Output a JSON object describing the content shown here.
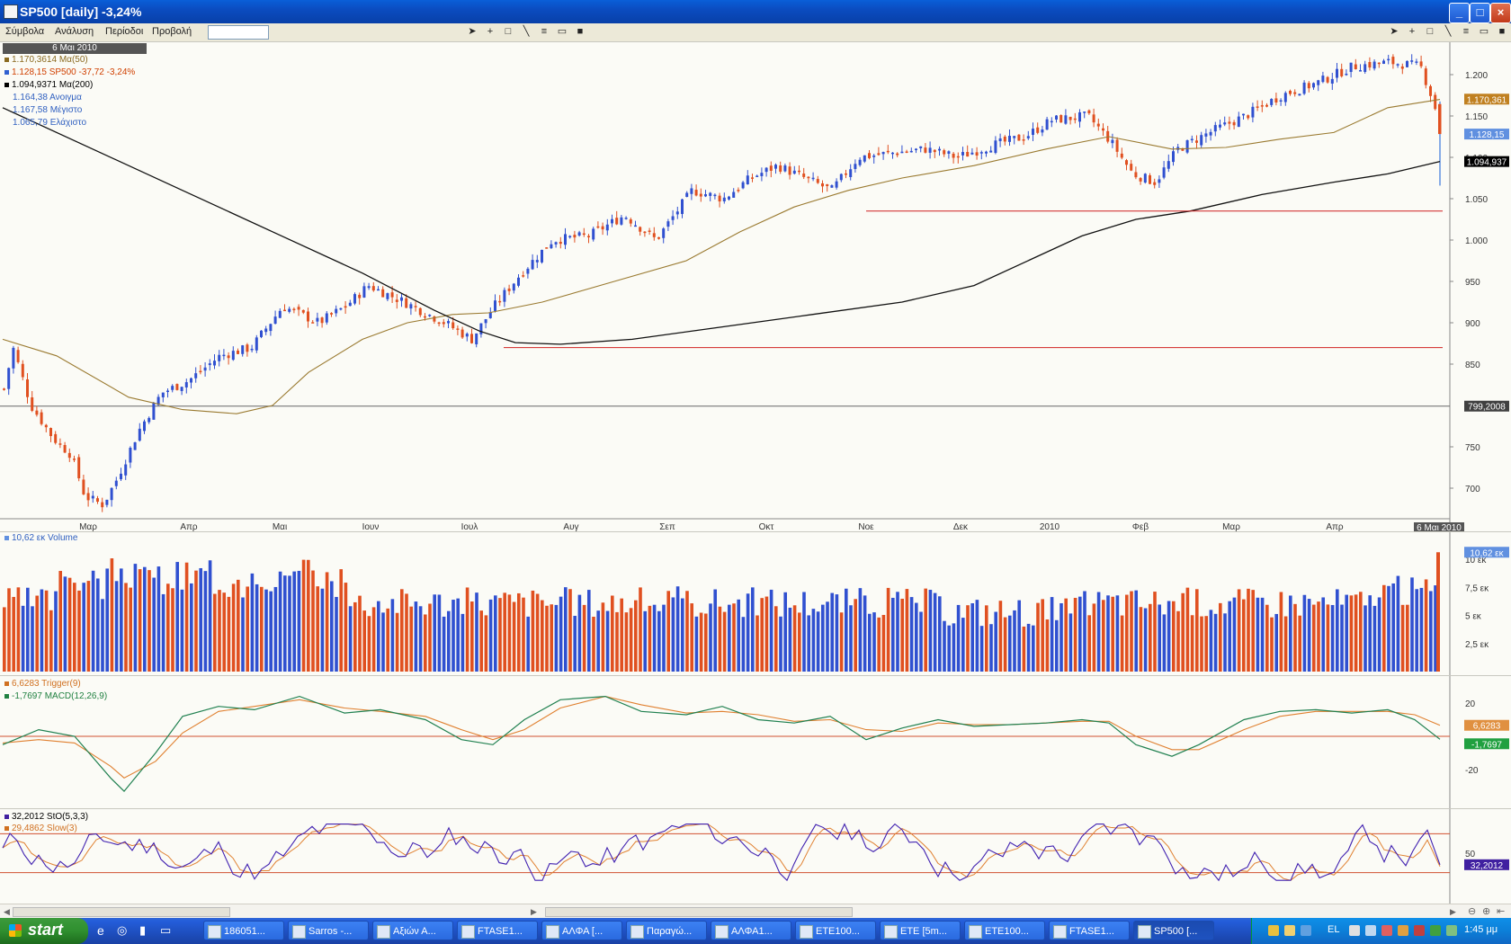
{
  "window": {
    "title": "SP500 [daily] -3,24%"
  },
  "menu": {
    "items": [
      "Σύμβολα",
      "Ανάλυση",
      "Περίοδοι",
      "Προβολή"
    ]
  },
  "price_panel": {
    "date_header": "6 Μαι 2010",
    "legend": [
      {
        "text": "1.170,3614 Mα(50)",
        "color": "#8a6a20"
      },
      {
        "text": "1.128,15 SP500 -37,72 -3,24%",
        "color": "#d04000",
        "prefix_color": "#3060d0"
      },
      {
        "text": "1.094,9371 Mα(200)",
        "color": "#000000"
      },
      {
        "text": "1.164,38 Ανοιγμα",
        "color": "#3060c0"
      },
      {
        "text": "1.167,58 Μέγιστο",
        "color": "#3060c0"
      },
      {
        "text": "1.065,79 Ελάχιστο",
        "color": "#3060c0"
      }
    ],
    "y_ticks": [
      "1.200",
      "1.150",
      "1.100",
      "1.050",
      "1.000",
      "950",
      "900",
      "850",
      "750",
      "700"
    ],
    "y_tick_values": [
      1200,
      1150,
      1100,
      1050,
      1000,
      950,
      900,
      850,
      750,
      700
    ],
    "price_tags": [
      {
        "text": "1.170,361",
        "value": 1170.36,
        "bg": "#c08020",
        "fg": "#ffffff"
      },
      {
        "text": "1.128,15",
        "value": 1128.15,
        "bg": "#6090e0",
        "fg": "#ffffff"
      },
      {
        "text": "1.094,937",
        "value": 1094.94,
        "bg": "#000000",
        "fg": "#ffffff"
      },
      {
        "text": "799,2008",
        "value": 799.2,
        "bg": "#404040",
        "fg": "#ffffff"
      }
    ],
    "x_labels": [
      "Μαρ",
      "Απρ",
      "Μαι",
      "Ιουν",
      "Ιουλ",
      "Αυγ",
      "Σεπ",
      "Οκτ",
      "Νοε",
      "Δεκ",
      "2010",
      "Φεβ",
      "Μαρ",
      "Απρ"
    ],
    "x_end_label": "6 Μαι 2010",
    "colors": {
      "up": "#3050d0",
      "down": "#e05020",
      "ma50": "#9a7a30",
      "ma200": "#111111",
      "support": "#d02020"
    }
  },
  "volume_panel": {
    "legend": "10,62 εκ Volume",
    "y_ticks": [
      "10 εκ",
      "7,5 εκ",
      "5 εκ",
      "2,5 εκ"
    ],
    "last_tag": "10,62 εκ"
  },
  "macd_panel": {
    "legend": [
      {
        "text": "6,6283 Trigger(9)",
        "color": "#d07020"
      },
      {
        "text": "-1,7697 MACD(12,26,9)",
        "color": "#208040"
      }
    ],
    "y_ticks": [
      "20",
      "-20"
    ],
    "tags": [
      {
        "text": "6,6283",
        "bg": "#e09040"
      },
      {
        "text": "-1,7697",
        "bg": "#20a040"
      }
    ]
  },
  "stoch_panel": {
    "legend": [
      {
        "text": "32,2012 StO(5,3,3)",
        "color": "#4020a0"
      },
      {
        "text": "29,4862 Slow(3)",
        "color": "#d07020"
      }
    ],
    "y_ticks": [
      "50"
    ],
    "tag": "32,2012"
  },
  "taskbar": {
    "start_label": "start",
    "tasks": [
      "186051...",
      "Sarros -...",
      "Αξιών Α...",
      "FTASE1...",
      "ΑΛΦΑ [...",
      "Παραγώ...",
      "ΑΛΦΑ1...",
      "ETE100...",
      "ETE [5m...",
      "ETE100...",
      "FTASE1...",
      "SP500 [..."
    ],
    "active_task": 11,
    "lang": "EL",
    "clock": "1:45 μμ"
  },
  "chart_data": {
    "type": "line",
    "title": "SP500 [daily]",
    "series": [
      {
        "name": "SP500",
        "points": [
          [
            0,
            820
          ],
          [
            10,
            870
          ],
          [
            30,
            800
          ],
          [
            55,
            760
          ],
          [
            75,
            740
          ],
          [
            90,
            690
          ],
          [
            110,
            680
          ],
          [
            125,
            710
          ],
          [
            150,
            770
          ],
          [
            175,
            815
          ],
          [
            205,
            830
          ],
          [
            240,
            860
          ],
          [
            275,
            870
          ],
          [
            310,
            920
          ],
          [
            350,
            900
          ],
          [
            380,
            920
          ],
          [
            405,
            945
          ],
          [
            445,
            925
          ],
          [
            490,
            900
          ],
          [
            520,
            880
          ],
          [
            545,
            920
          ],
          [
            575,
            960
          ],
          [
            610,
            1000
          ],
          [
            650,
            1005
          ],
          [
            690,
            1030
          ],
          [
            725,
            1000
          ],
          [
            765,
            1060
          ],
          [
            800,
            1050
          ],
          [
            830,
            1075
          ],
          [
            860,
            1090
          ],
          [
            890,
            1075
          ],
          [
            920,
            1060
          ],
          [
            950,
            1100
          ],
          [
            985,
            1105
          ],
          [
            1025,
            1110
          ],
          [
            1060,
            1100
          ],
          [
            1100,
            1115
          ],
          [
            1135,
            1125
          ],
          [
            1165,
            1145
          ],
          [
            1205,
            1150
          ],
          [
            1230,
            1120
          ],
          [
            1255,
            1080
          ],
          [
            1280,
            1070
          ],
          [
            1305,
            1110
          ],
          [
            1340,
            1130
          ],
          [
            1380,
            1150
          ],
          [
            1420,
            1175
          ],
          [
            1460,
            1190
          ],
          [
            1500,
            1210
          ],
          [
            1540,
            1215
          ],
          [
            1575,
            1210
          ],
          [
            1590,
            1165
          ],
          [
            1598,
            1128
          ]
        ]
      },
      {
        "name": "Mα(50)",
        "points": [
          [
            0,
            880
          ],
          [
            60,
            860
          ],
          [
            140,
            810
          ],
          [
            200,
            795
          ],
          [
            260,
            790
          ],
          [
            300,
            800
          ],
          [
            340,
            840
          ],
          [
            400,
            880
          ],
          [
            450,
            900
          ],
          [
            500,
            910
          ],
          [
            540,
            912
          ],
          [
            600,
            925
          ],
          [
            680,
            950
          ],
          [
            760,
            975
          ],
          [
            820,
            1010
          ],
          [
            880,
            1040
          ],
          [
            940,
            1060
          ],
          [
            1000,
            1075
          ],
          [
            1080,
            1090
          ],
          [
            1160,
            1110
          ],
          [
            1230,
            1125
          ],
          [
            1300,
            1110
          ],
          [
            1360,
            1112
          ],
          [
            1420,
            1122
          ],
          [
            1480,
            1130
          ],
          [
            1540,
            1160
          ],
          [
            1598,
            1170
          ]
        ]
      },
      {
        "name": "Mα(200)",
        "points": [
          [
            0,
            1160
          ],
          [
            100,
            1110
          ],
          [
            200,
            1060
          ],
          [
            300,
            1010
          ],
          [
            400,
            960
          ],
          [
            480,
            915
          ],
          [
            530,
            890
          ],
          [
            570,
            876
          ],
          [
            620,
            874
          ],
          [
            700,
            880
          ],
          [
            800,
            895
          ],
          [
            900,
            910
          ],
          [
            1000,
            925
          ],
          [
            1080,
            945
          ],
          [
            1150,
            980
          ],
          [
            1200,
            1005
          ],
          [
            1260,
            1025
          ],
          [
            1320,
            1035
          ],
          [
            1400,
            1055
          ],
          [
            1480,
            1070
          ],
          [
            1540,
            1080
          ],
          [
            1598,
            1095
          ]
        ]
      }
    ],
    "support_lines": [
      870,
      1035
    ]
  }
}
